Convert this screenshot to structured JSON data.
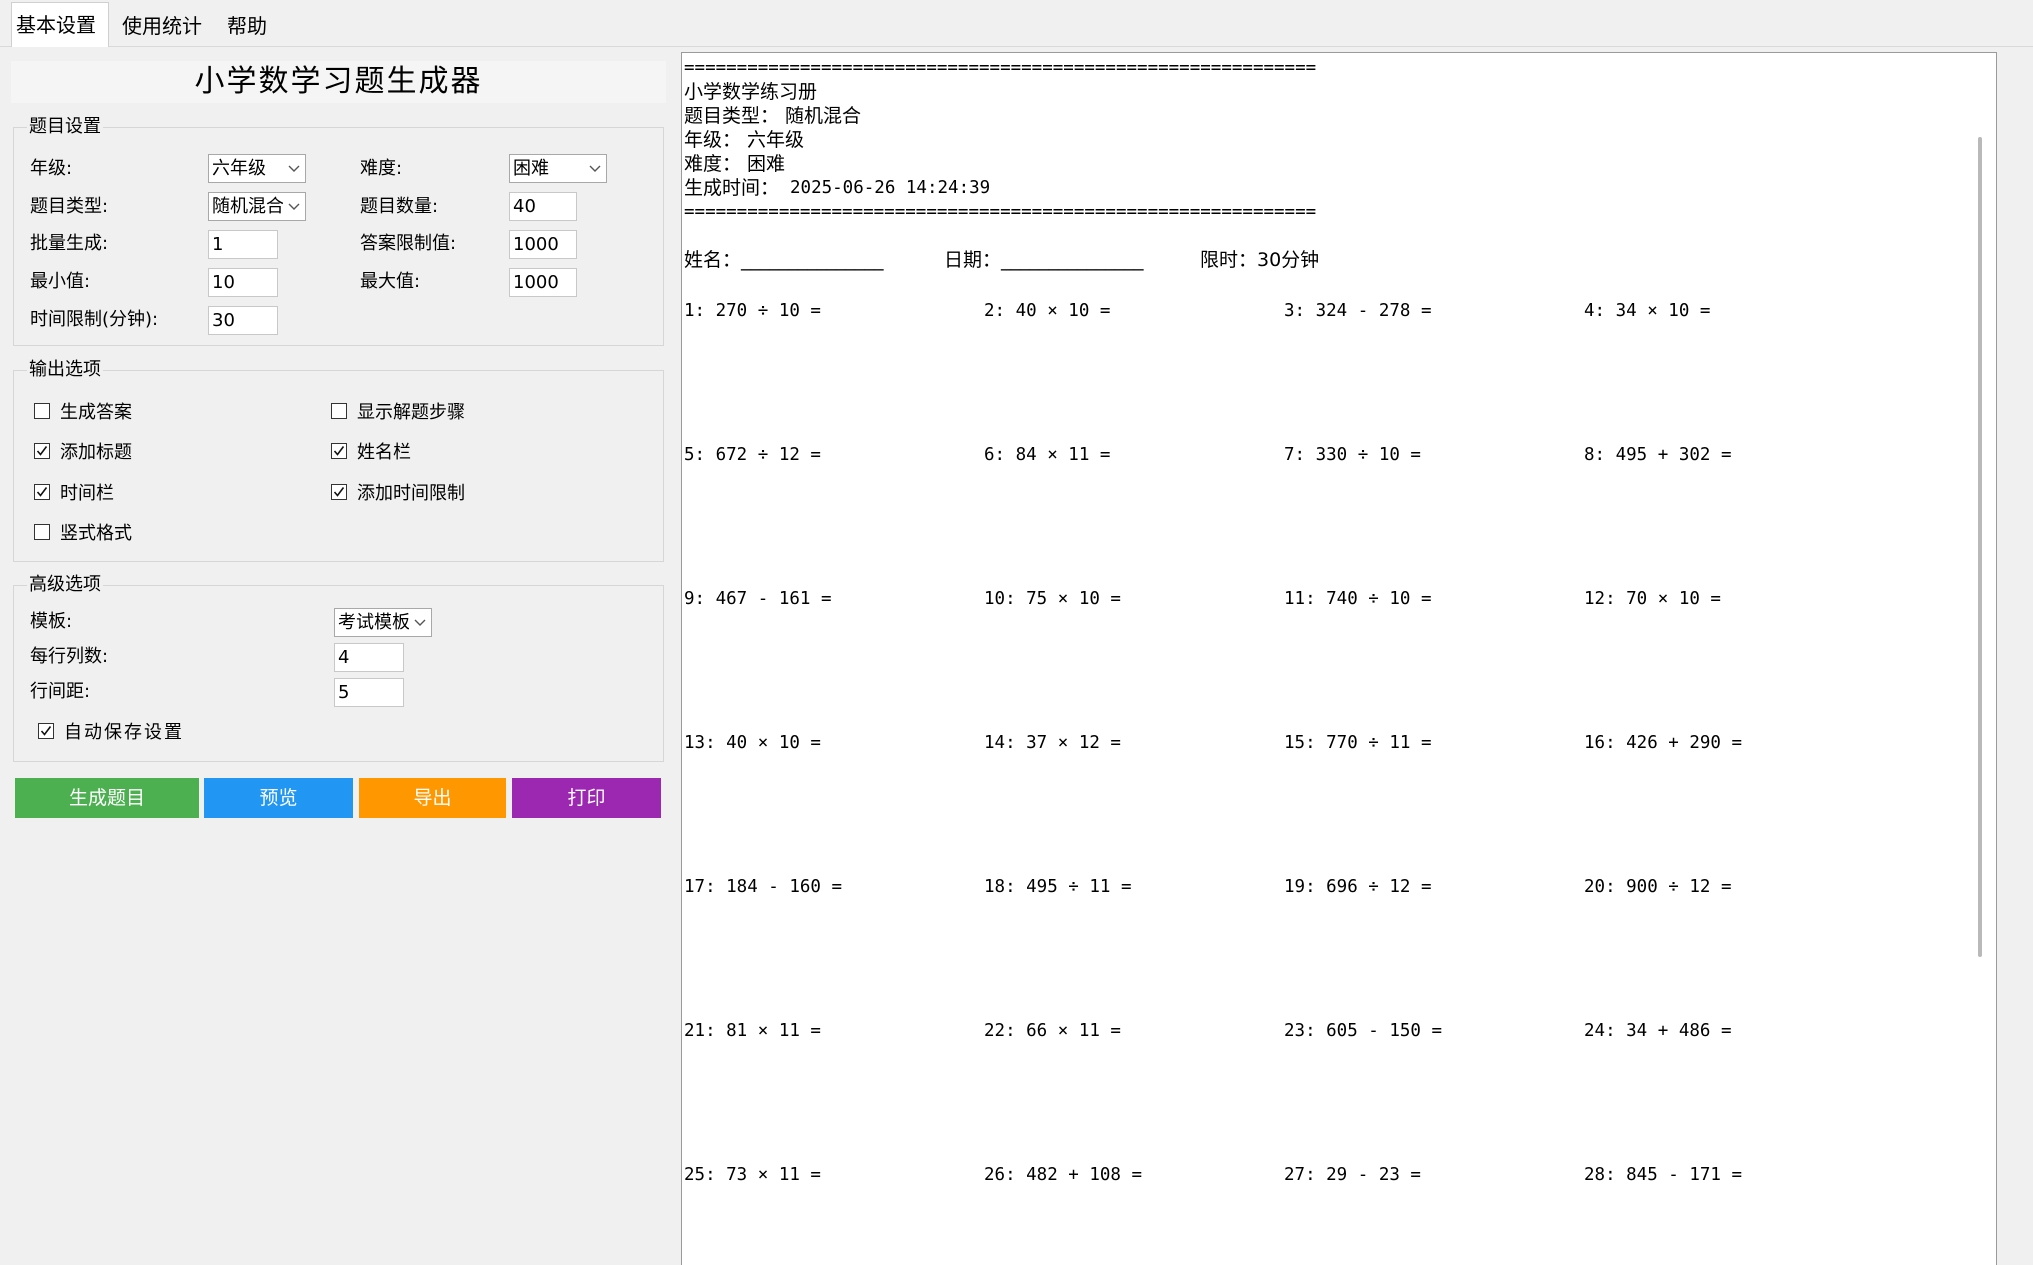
{
  "tabs": [
    {
      "label": "基本设置",
      "active": true
    },
    {
      "label": "使用统计",
      "active": false
    },
    {
      "label": "帮助",
      "active": false
    }
  ],
  "app_title": "小学数学习题生成器",
  "question_settings": {
    "legend": "题目设置",
    "grade_label": "年级:",
    "grade_value": "六年级",
    "difficulty_label": "难度:",
    "difficulty_value": "困难",
    "type_label": "题目类型:",
    "type_value": "随机混合",
    "count_label": "题目数量:",
    "count_value": "40",
    "batch_label": "批量生成:",
    "batch_value": "1",
    "answer_limit_label": "答案限制值:",
    "answer_limit_value": "1000",
    "min_label": "最小值:",
    "min_value": "10",
    "max_label": "最大值:",
    "max_value": "1000",
    "time_label": "时间限制(分钟):",
    "time_value": "30"
  },
  "output_options": {
    "legend": "输出选项",
    "items": [
      {
        "label": "生成答案",
        "checked": false
      },
      {
        "label": "显示解题步骤",
        "checked": false
      },
      {
        "label": "添加标题",
        "checked": true
      },
      {
        "label": "姓名栏",
        "checked": true
      },
      {
        "label": "时间栏",
        "checked": true
      },
      {
        "label": "添加时间限制",
        "checked": true
      },
      {
        "label": "竖式格式",
        "checked": false
      }
    ]
  },
  "advanced_options": {
    "legend": "高级选项",
    "template_label": "模板:",
    "template_value": "考试模板",
    "columns_label": "每行列数:",
    "columns_value": "4",
    "spacing_label": "行间距:",
    "spacing_value": "5",
    "autosave_label": "自动保存设置",
    "autosave_checked": true
  },
  "buttons": {
    "generate": "生成题目",
    "preview": "预览",
    "export": "导出",
    "print": "打印",
    "colors": {
      "generate": "#4caf50",
      "preview": "#2196f3",
      "export": "#ff9800",
      "print": "#9c27b0"
    }
  },
  "preview": {
    "separator": "============================================================",
    "title": "小学数学练习册",
    "type_line": "题目类型： 随机混合",
    "grade_line": "年级： 六年级",
    "difficulty_line": "难度： 困难",
    "time_label": "生成时间：",
    "time_value": "2025-06-26 14:24:39",
    "name_field": "姓名：_______________",
    "date_field": "日期：_______________",
    "limit_field": "限时：30分钟",
    "problems": [
      "1: 270 ÷ 10 =",
      "2: 40 × 10 =",
      "3: 324 - 278 =",
      "4: 34 × 10 =",
      "5: 672 ÷ 12 =",
      "6: 84 × 11 =",
      "7: 330 ÷ 10 =",
      "8: 495 + 302 =",
      "9: 467 - 161 =",
      "10: 75 × 10 =",
      "11: 740 ÷ 10 =",
      "12: 70 × 10 =",
      "13: 40 × 10 =",
      "14: 37 × 12 =",
      "15: 770 ÷ 11 =",
      "16: 426 + 290 =",
      "17: 184 - 160 =",
      "18: 495 ÷ 11 =",
      "19: 696 ÷ 12 =",
      "20: 900 ÷ 12 =",
      "21: 81 × 11 =",
      "22: 66 × 11 =",
      "23: 605 - 150 =",
      "24: 34 + 486 =",
      "25: 73 × 11 =",
      "26: 482 + 108 =",
      "27: 29 - 23 =",
      "28: 845 - 171 ="
    ]
  }
}
